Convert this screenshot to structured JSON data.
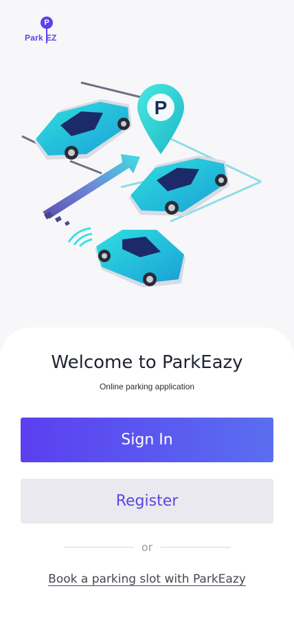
{
  "logo": {
    "pin_letter": "P",
    "text_part1": "Park",
    "text_part2": "EZ"
  },
  "illustration": {
    "sign_letter": "P"
  },
  "welcome": {
    "title": "Welcome to ParkEazy",
    "subtitle": "Online parking application"
  },
  "buttons": {
    "sign_in": "Sign In",
    "register": "Register"
  },
  "divider": {
    "or_label": "or"
  },
  "book_link": "Book a parking slot with ParkEazy",
  "colors": {
    "brand": "#5b43e8",
    "car_teal": "#21c7d6",
    "register_bg": "#e9e9ef"
  }
}
